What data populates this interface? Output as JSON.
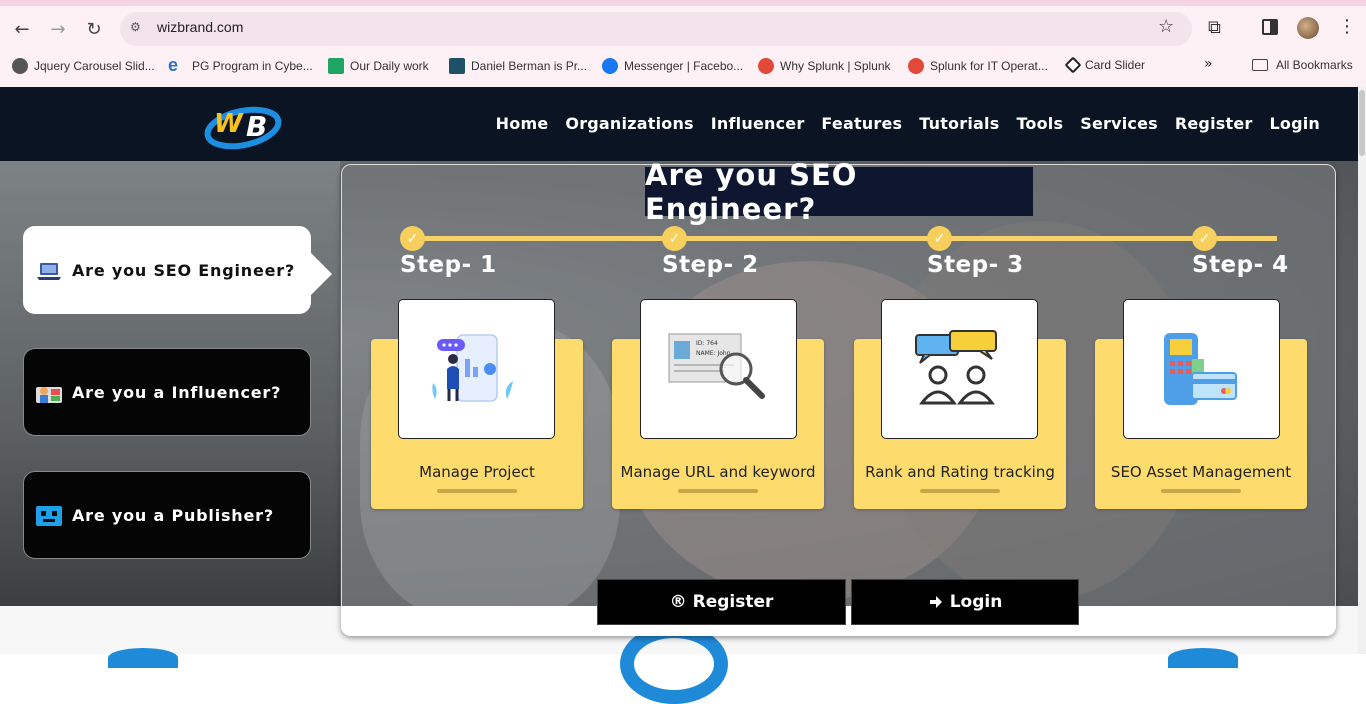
{
  "browser": {
    "url": "wizbrand.com",
    "bookmarks": [
      {
        "label": "Jquery Carousel Slid...",
        "icon": "globe-icon",
        "color": "#555555"
      },
      {
        "label": "PG Program in Cybe...",
        "icon": "e-logo-icon",
        "color": "#2a73c6"
      },
      {
        "label": "Our Daily work",
        "icon": "sheets-icon",
        "color": "#1fa463"
      },
      {
        "label": "Daniel Berman is Pr...",
        "icon": "site-icon",
        "color": "#1e5068"
      },
      {
        "label": "Messenger | Facebo...",
        "icon": "facebook-icon",
        "color": "#1877f2"
      },
      {
        "label": "Why Splunk | Splunk",
        "icon": "splunk-icon",
        "color": "#e2493b"
      },
      {
        "label": "Splunk for IT Operat...",
        "icon": "splunk-icon",
        "color": "#e2493b"
      },
      {
        "label": "Card Slider",
        "icon": "codepen-icon",
        "color": "#222222"
      }
    ],
    "more_bookmarks": "»",
    "all_bookmarks": "All Bookmarks"
  },
  "header": {
    "nav": [
      "Home",
      "Organizations",
      "Influencer",
      "Features",
      "Tutorials",
      "Tools",
      "Services",
      "Register",
      "Login"
    ]
  },
  "roles": [
    {
      "label": "Are you SEO Engineer?",
      "active": true
    },
    {
      "label": "Are you a Influencer?",
      "active": false
    },
    {
      "label": "Are you a Publisher?",
      "active": false
    }
  ],
  "panel": {
    "title": "Are you SEO Engineer?",
    "steps": [
      "Step- 1",
      "Step- 2",
      "Step- 3",
      "Step- 4"
    ],
    "check_mark": "✓",
    "cards": [
      {
        "label": "Manage Project",
        "icon": "project-dashboard-icon"
      },
      {
        "label": "Manage URL and keyword",
        "icon": "id-card-search-icon"
      },
      {
        "label": "Rank and Rating tracking",
        "icon": "chat-users-icon"
      },
      {
        "label": "SEO Asset Management",
        "icon": "payment-terminal-icon"
      }
    ],
    "register_label": "Register",
    "login_label": "Login",
    "register_symbol": "®"
  },
  "colors": {
    "header_bg": "#0a1423",
    "card_yellow": "#fddc6d",
    "step_yellow": "#f6cf5c",
    "title_bg": "#0f1730"
  }
}
